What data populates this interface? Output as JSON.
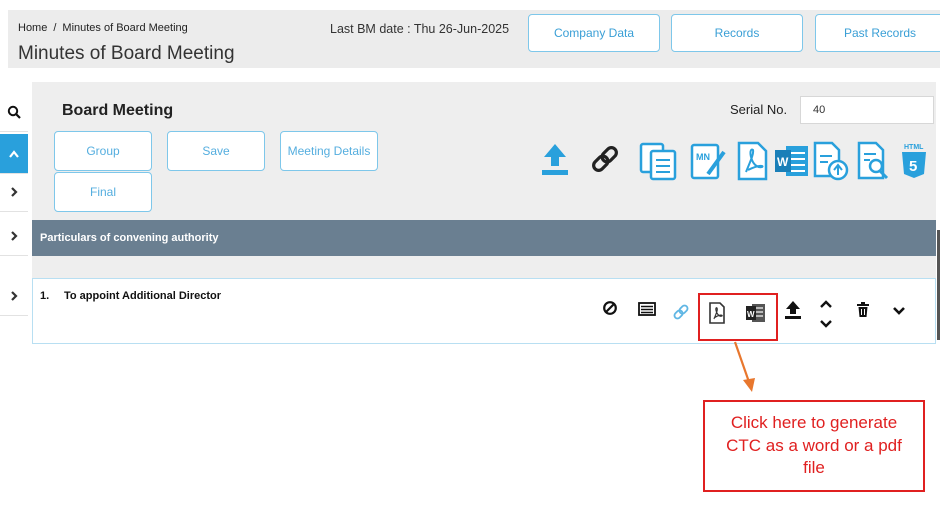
{
  "header": {
    "breadcrumb": [
      "Home",
      "/",
      "Minutes of Board Meeting"
    ],
    "title": "Minutes of Board Meeting",
    "last_bm_date": "Last BM date : Thu 26-Jun-2025",
    "buttons": [
      "Company Data",
      "Records",
      "Past Records"
    ]
  },
  "sidebar": {
    "icons": [
      "search-icon",
      "chevron-up-icon",
      "chevron-right-icon",
      "chevron-right-icon",
      "chevron-right-icon"
    ]
  },
  "board_meeting": {
    "title": "Board Meeting",
    "serial_label": "Serial No.",
    "serial_value": "40",
    "buttons": {
      "group": "Group",
      "save": "Save",
      "meeting_details": "Meeting Details",
      "final": "Final"
    },
    "toolbar_icons": [
      "upload-icon",
      "link-icon",
      "copy-icon",
      "minutes-edit-icon",
      "pdf-icon",
      "word-icon",
      "file-upload-icon",
      "file-search-icon",
      "html5-icon"
    ]
  },
  "section": {
    "title": "Particulars of convening authority"
  },
  "agenda_item": {
    "number": "1.",
    "text": "To appoint Additional Director",
    "icons": [
      "block-icon",
      "list-icon",
      "link-icon",
      "pdf-icon",
      "word-icon",
      "upload-icon",
      "move-icon",
      "delete-icon",
      "chevron-down-icon"
    ]
  },
  "annotation": {
    "text": "Click here to generate CTC as a word or a pdf file",
    "color": "#e02020"
  },
  "colors": {
    "accent": "#29a0dc",
    "section_bar": "#6a7f91",
    "button_border": "#7ec7ea"
  }
}
